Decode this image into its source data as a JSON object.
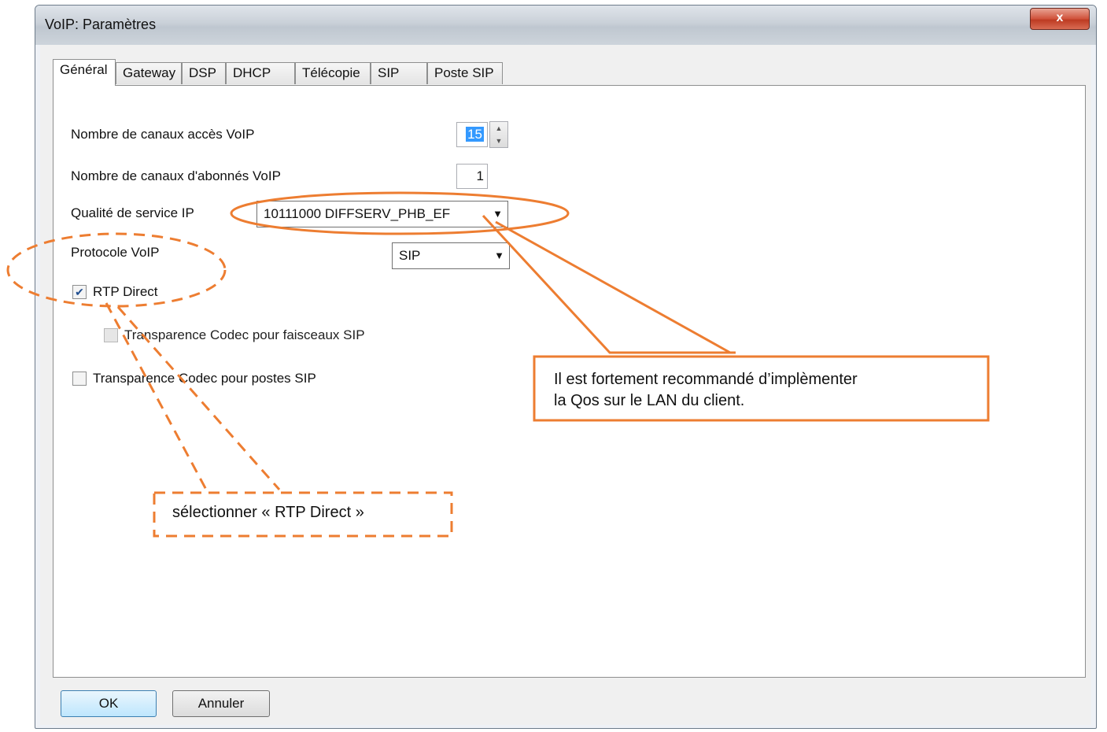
{
  "window": {
    "title": "VoIP: Paramètres",
    "close_glyph": "x"
  },
  "tabs": [
    {
      "label": "Général",
      "active": true
    },
    {
      "label": "Gateway"
    },
    {
      "label": "DSP"
    },
    {
      "label": "DHCP"
    },
    {
      "label": "Télécopie"
    },
    {
      "label": "SIP"
    },
    {
      "label": "Poste SIP"
    }
  ],
  "form": {
    "voip_access_channels_label": "Nombre de canaux accès VoIP",
    "voip_access_channels_value": "15",
    "voip_subscriber_channels_label": "Nombre de canaux d'abonnés VoIP",
    "voip_subscriber_channels_value": "1",
    "qos_label": "Qualité de service IP",
    "qos_value": "10111000  DIFFSERV_PHB_EF",
    "protocol_label": "Protocole VoIP",
    "protocol_value": "SIP",
    "rtp_direct_label": "RTP Direct",
    "rtp_direct_checked": true,
    "codec_trunk_label": "Transparence Codec pour faisceaux SIP",
    "codec_trunk_checked": false,
    "codec_phone_label": "Transparence Codec pour postes SIP",
    "codec_phone_checked": false
  },
  "buttons": {
    "ok": "OK",
    "cancel": "Annuler"
  },
  "annotations": {
    "qos_note_line1": "Il est fortement recommandé d’implèmenter",
    "qos_note_line2": "la Qos sur le LAN du client.",
    "rtp_note": "sélectionner « RTP Direct »",
    "accent_color": "#ed7d31"
  },
  "icons": {
    "spin_up": "triangle-up",
    "spin_down": "triangle-down",
    "dropdown": "triangle-down",
    "check": "check-mark"
  }
}
